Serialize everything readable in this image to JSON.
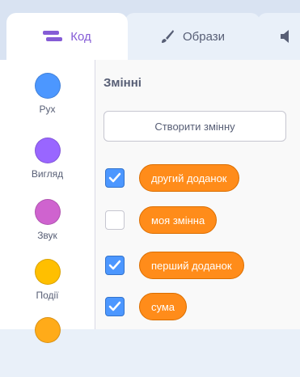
{
  "tabs": [
    {
      "label": "Код",
      "icon": "code-icon",
      "active": true
    },
    {
      "label": "Образи",
      "icon": "brush-icon",
      "active": false
    },
    {
      "label": "",
      "icon": "sound-icon",
      "active": false
    }
  ],
  "categories": [
    {
      "label": "Рух",
      "color": "#4c97ff"
    },
    {
      "label": "Вигляд",
      "color": "#9966ff"
    },
    {
      "label": "Звук",
      "color": "#cf63cf"
    },
    {
      "label": "Події",
      "color": "#ffbf00"
    },
    {
      "label": "",
      "color": "#ffab19"
    }
  ],
  "palette": {
    "section_title": "Змінні",
    "make_variable_label": "Створити змінну",
    "variables": [
      {
        "name": "другий доданок",
        "checked": true
      },
      {
        "name": "моя змінна",
        "checked": false
      },
      {
        "name": "перший доданок",
        "checked": true
      },
      {
        "name": "сума",
        "checked": true
      }
    ]
  },
  "colors": {
    "accent": "#855cd6",
    "variables_block": "#ff8c1a",
    "checkbox_on": "#4c97ff"
  }
}
